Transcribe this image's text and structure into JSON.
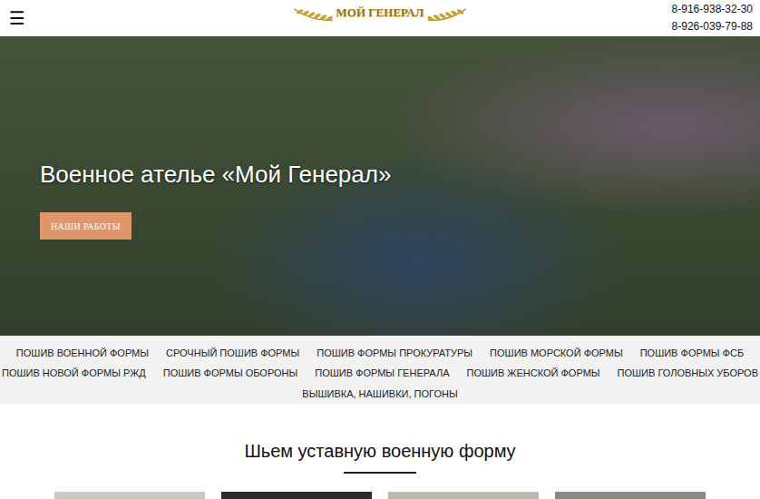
{
  "header": {
    "menu_icon": "☰",
    "logo": "МОЙ ГЕНЕРАЛ",
    "phones": [
      "8-916-938-32-30",
      "8-926-039-79-88"
    ]
  },
  "hero": {
    "title": "Военное ателье «Мой Генерал»",
    "button": "НАШИ РАБОТЫ"
  },
  "nav": {
    "rows": [
      [
        "ПОШИВ ВОЕННОЙ ФОРМЫ",
        "СРОЧНЫЙ ПОШИВ ФОРМЫ",
        "ПОШИВ ФОРМЫ ПРОКУРАТУРЫ",
        "ПОШИВ МОРСКОЙ ФОРМЫ",
        "ПОШИВ ФОРМЫ ФСБ"
      ],
      [
        "ПОШИВ НОВОЙ ФОРМЫ РЖД",
        "ПОШИВ ФОРМЫ ОБОРОНЫ",
        "ПОШИВ ФОРМЫ ГЕНЕРАЛА",
        "ПОШИВ ЖЕНСКОЙ ФОРМЫ",
        "ПОШИВ ГОЛОВНЫХ УБОРОВ"
      ],
      [
        "ВЫШИВКА, НАШИВКИ, ПОГОНЫ"
      ]
    ]
  },
  "section": {
    "title": "Шьем уставную военную форму"
  }
}
